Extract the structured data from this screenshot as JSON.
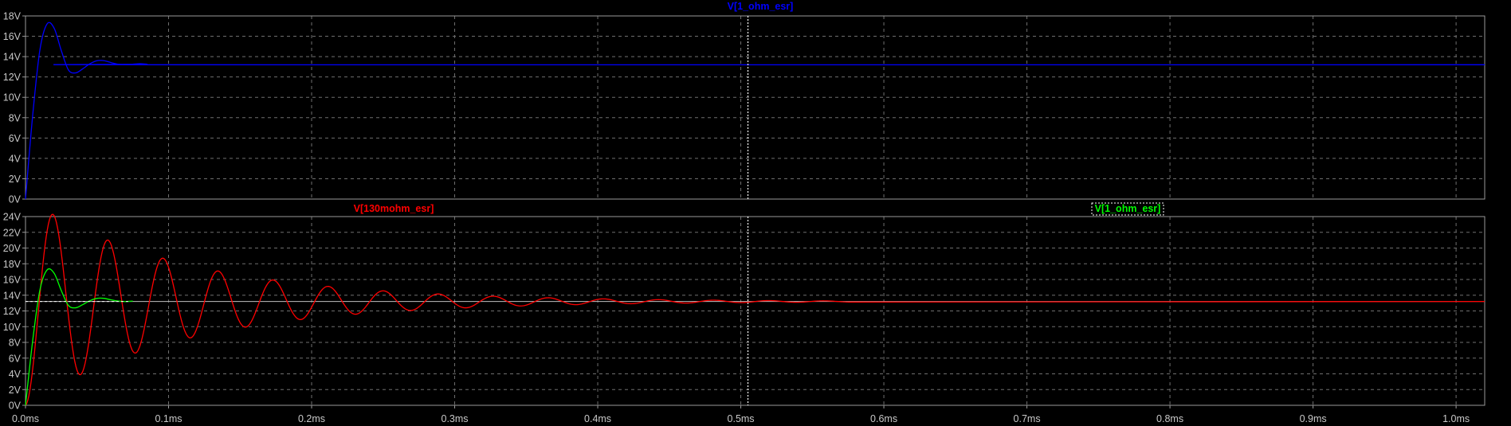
{
  "colors": {
    "background": "#000000",
    "axes_frame": "#9a9a9a",
    "grid": "#6f6f6f",
    "tick_text": "#c8c8c8",
    "cursor": "#ffffff",
    "trace_blue": "#0000ff",
    "trace_red": "#ff0000",
    "trace_green": "#00ff00"
  },
  "cursor": {
    "x": 0.505
  },
  "chart_data": [
    {
      "type": "line",
      "title": "V[1_ohm_esr]",
      "xlabel": "",
      "ylabel": "",
      "xlim": [
        0.0,
        1.02
      ],
      "ylim": [
        0,
        18
      ],
      "x_ticks": [
        0.0,
        0.1,
        0.2,
        0.3,
        0.4,
        0.5,
        0.6,
        0.7,
        0.8,
        0.9,
        1.0
      ],
      "y_ticks": [
        0,
        2,
        4,
        6,
        8,
        10,
        12,
        14,
        16,
        18
      ],
      "y_tick_labels": [
        "0V",
        "2V",
        "4V",
        "6V",
        "8V",
        "10V",
        "12V",
        "14V",
        "16V",
        "18V"
      ],
      "grid": true,
      "series": [
        {
          "name": "V[1_ohm_esr]",
          "color": "#0000ff",
          "x": [
            0.0,
            0.005,
            0.01,
            0.015,
            0.02,
            0.025,
            0.03,
            0.035,
            0.04,
            0.045,
            0.05,
            0.055,
            0.06,
            0.065,
            0.07,
            0.075,
            0.08,
            0.085,
            0.09,
            1.02
          ],
          "y": [
            0.0,
            8.2,
            14.6,
            17.2,
            16.8,
            14.6,
            12.7,
            12.4,
            12.8,
            13.3,
            13.6,
            13.6,
            13.4,
            13.25,
            13.2,
            13.25,
            13.3,
            13.25,
            13.2,
            13.2
          ]
        }
      ]
    },
    {
      "type": "line",
      "title": "V[130mohm_esr]",
      "xlabel": "",
      "ylabel": "",
      "xlim": [
        0.0,
        1.02
      ],
      "ylim": [
        0,
        24
      ],
      "x_ticks": [
        0.0,
        0.1,
        0.2,
        0.3,
        0.4,
        0.5,
        0.6,
        0.7,
        0.8,
        0.9,
        1.0
      ],
      "x_tick_labels": [
        "0.0ms",
        "0.1ms",
        "0.2ms",
        "0.3ms",
        "0.4ms",
        "0.5ms",
        "0.6ms",
        "0.7ms",
        "0.8ms",
        "0.9ms",
        "1.0ms"
      ],
      "y_ticks": [
        0,
        2,
        4,
        6,
        8,
        10,
        12,
        14,
        16,
        18,
        20,
        22,
        24
      ],
      "y_tick_labels": [
        "0V",
        "2V",
        "4V",
        "6V",
        "8V",
        "10V",
        "12V",
        "14V",
        "16V",
        "18V",
        "20V",
        "22V",
        "24V"
      ],
      "grid": true,
      "reference_line": 13.2,
      "legend": [
        "V[130mohm_esr]",
        "V[1_ohm_esr]"
      ],
      "series": [
        {
          "name": "V[130mohm_esr]",
          "color": "#ff0000",
          "model": {
            "steady": 13.2,
            "amplitude": 13.2,
            "decay_ms": 0.11,
            "period_ms": 0.0385,
            "x_start": 0.0,
            "x_end": 0.58
          }
        },
        {
          "name": "V[1_ohm_esr]",
          "color": "#00ff00",
          "x": [
            0.0,
            0.005,
            0.01,
            0.015,
            0.02,
            0.025,
            0.03,
            0.035,
            0.04,
            0.045,
            0.05,
            0.055,
            0.06,
            0.065,
            0.07,
            0.075
          ],
          "y": [
            0.0,
            8.2,
            14.6,
            17.2,
            16.8,
            14.6,
            12.7,
            12.4,
            12.8,
            13.3,
            13.6,
            13.6,
            13.4,
            13.25,
            13.2,
            13.25
          ]
        }
      ]
    }
  ]
}
